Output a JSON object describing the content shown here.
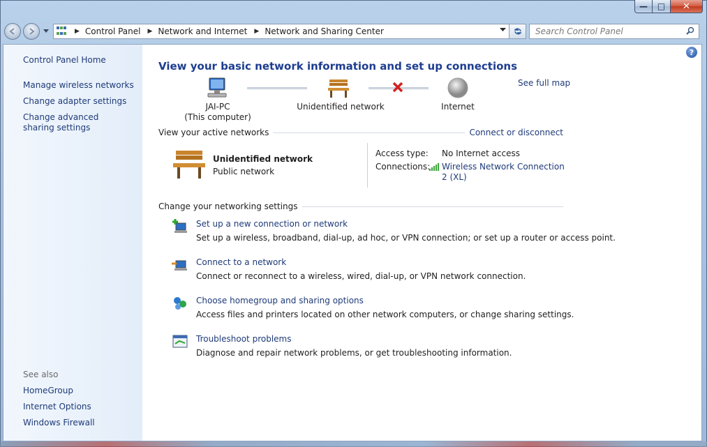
{
  "window": {
    "caption_minimize": "—",
    "caption_maximize": "□",
    "caption_close": "✕"
  },
  "navbar": {
    "breadcrumbs": [
      "Control Panel",
      "Network and Internet",
      "Network and Sharing Center"
    ],
    "search_placeholder": "Search Control Panel"
  },
  "sidebar": {
    "home": "Control Panel Home",
    "links": [
      "Manage wireless networks",
      "Change adapter settings",
      "Change advanced sharing settings"
    ],
    "see_also_label": "See also",
    "see_also": [
      "HomeGroup",
      "Internet Options",
      "Windows Firewall"
    ]
  },
  "main": {
    "title": "View your basic network information and set up connections",
    "see_full_map": "See full map",
    "map": {
      "computer_name": "JAI-PC",
      "computer_sub": "(This computer)",
      "network": "Unidentified network",
      "internet": "Internet"
    },
    "active_networks": {
      "heading": "View your active networks",
      "action": "Connect or disconnect",
      "network_name": "Unidentified network",
      "network_type": "Public network",
      "access_type_label": "Access type:",
      "access_type_value": "No Internet access",
      "connections_label": "Connections:",
      "connection_name": "Wireless Network Connection 2 (XL)"
    },
    "settings": {
      "heading": "Change your networking settings",
      "tasks": [
        {
          "link": "Set up a new connection or network",
          "desc": "Set up a wireless, broadband, dial-up, ad hoc, or VPN connection; or set up a router or access point."
        },
        {
          "link": "Connect to a network",
          "desc": "Connect or reconnect to a wireless, wired, dial-up, or VPN network connection."
        },
        {
          "link": "Choose homegroup and sharing options",
          "desc": "Access files and printers located on other network computers, or change sharing settings."
        },
        {
          "link": "Troubleshoot problems",
          "desc": "Diagnose and repair network problems, or get troubleshooting information."
        }
      ]
    }
  },
  "colors": {
    "link": "#1e3a78",
    "title": "#1d3d8f",
    "sidebar_bg": "#e3edf9"
  }
}
